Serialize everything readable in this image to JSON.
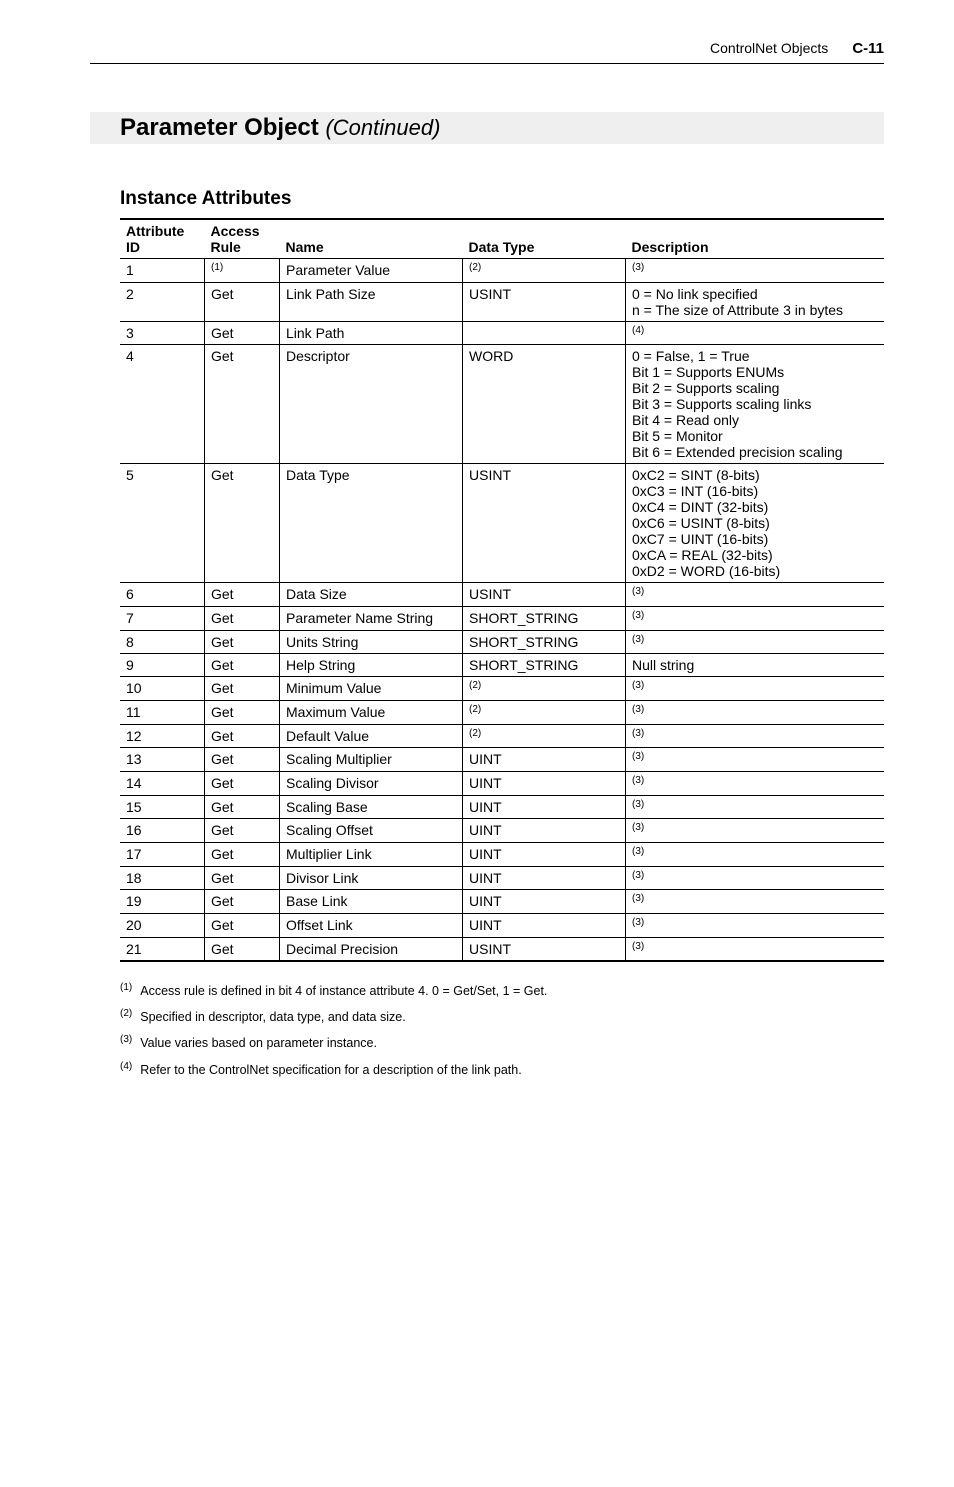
{
  "header": {
    "title": "ControlNet Objects",
    "page": "C-11"
  },
  "h1": {
    "main": "Parameter Object",
    "cont": "(Continued)"
  },
  "h2": "Instance Attributes",
  "thead": {
    "c1a": "Attribute",
    "c1b": "ID",
    "c2a": "Access",
    "c2b": "Rule",
    "c3": "Name",
    "c4": "Data Type",
    "c5": "Description"
  },
  "rows": [
    {
      "id": "1",
      "rule": "(1)",
      "name": "Parameter Value",
      "dtype": "(2)",
      "desc": "(3)"
    },
    {
      "id": "2",
      "rule": "Get",
      "name": "Link Path Size",
      "dtype": "USINT",
      "desc": "0 = No link specified\nn = The size of Attribute 3 in bytes"
    },
    {
      "id": "3",
      "rule": "Get",
      "name": "Link Path",
      "dtype": "",
      "desc": "(4)"
    },
    {
      "id": "4",
      "rule": "Get",
      "name": "Descriptor",
      "dtype": "WORD",
      "desc": "0 = False, 1 = True\nBit 1 = Supports ENUMs\nBit 2 = Supports scaling\nBit 3 = Supports scaling links\nBit 4 = Read only\nBit 5 = Monitor\nBit 6 = Extended precision scaling"
    },
    {
      "id": "5",
      "rule": "Get",
      "name": "Data Type",
      "dtype": "USINT",
      "desc": "0xC2 = SINT (8-bits)\n0xC3 = INT (16-bits)\n0xC4 = DINT (32-bits)\n0xC6 = USINT (8-bits)\n0xC7 = UINT (16-bits)\n0xCA = REAL (32-bits)\n0xD2 = WORD (16-bits)"
    },
    {
      "id": "6",
      "rule": "Get",
      "name": "Data Size",
      "dtype": "USINT",
      "desc": "(3)"
    },
    {
      "id": "7",
      "rule": "Get",
      "name": "Parameter Name String",
      "dtype": "SHORT_STRING",
      "desc": "(3)"
    },
    {
      "id": "8",
      "rule": "Get",
      "name": "Units String",
      "dtype": "SHORT_STRING",
      "desc": "(3)"
    },
    {
      "id": "9",
      "rule": "Get",
      "name": "Help String",
      "dtype": "SHORT_STRING",
      "desc": "Null string"
    },
    {
      "id": "10",
      "rule": "Get",
      "name": "Minimum Value",
      "dtype": "(2)",
      "desc": "(3)"
    },
    {
      "id": "11",
      "rule": "Get",
      "name": "Maximum Value",
      "dtype": "(2)",
      "desc": "(3)"
    },
    {
      "id": "12",
      "rule": "Get",
      "name": "Default Value",
      "dtype": "(2)",
      "desc": "(3)"
    },
    {
      "id": "13",
      "rule": "Get",
      "name": "Scaling Multiplier",
      "dtype": "UINT",
      "desc": "(3)"
    },
    {
      "id": "14",
      "rule": "Get",
      "name": "Scaling Divisor",
      "dtype": "UINT",
      "desc": "(3)"
    },
    {
      "id": "15",
      "rule": "Get",
      "name": "Scaling Base",
      "dtype": "UINT",
      "desc": "(3)"
    },
    {
      "id": "16",
      "rule": "Get",
      "name": "Scaling Offset",
      "dtype": "UINT",
      "desc": "(3)"
    },
    {
      "id": "17",
      "rule": "Get",
      "name": "Multiplier Link",
      "dtype": "UINT",
      "desc": "(3)"
    },
    {
      "id": "18",
      "rule": "Get",
      "name": "Divisor Link",
      "dtype": "UINT",
      "desc": "(3)"
    },
    {
      "id": "19",
      "rule": "Get",
      "name": "Base Link",
      "dtype": "UINT",
      "desc": "(3)"
    },
    {
      "id": "20",
      "rule": "Get",
      "name": "Offset Link",
      "dtype": "UINT",
      "desc": "(3)"
    },
    {
      "id": "21",
      "rule": "Get",
      "name": "Decimal Precision",
      "dtype": "USINT",
      "desc": "(3)"
    }
  ],
  "footnotes": {
    "f1": "Access rule is defined in bit 4 of instance attribute 4. 0 = Get/Set, 1 = Get.",
    "f2": "Specified in descriptor, data type, and data size.",
    "f3": "Value varies based on parameter instance.",
    "f4": "Refer to the ControlNet specification for a description of the link path."
  }
}
